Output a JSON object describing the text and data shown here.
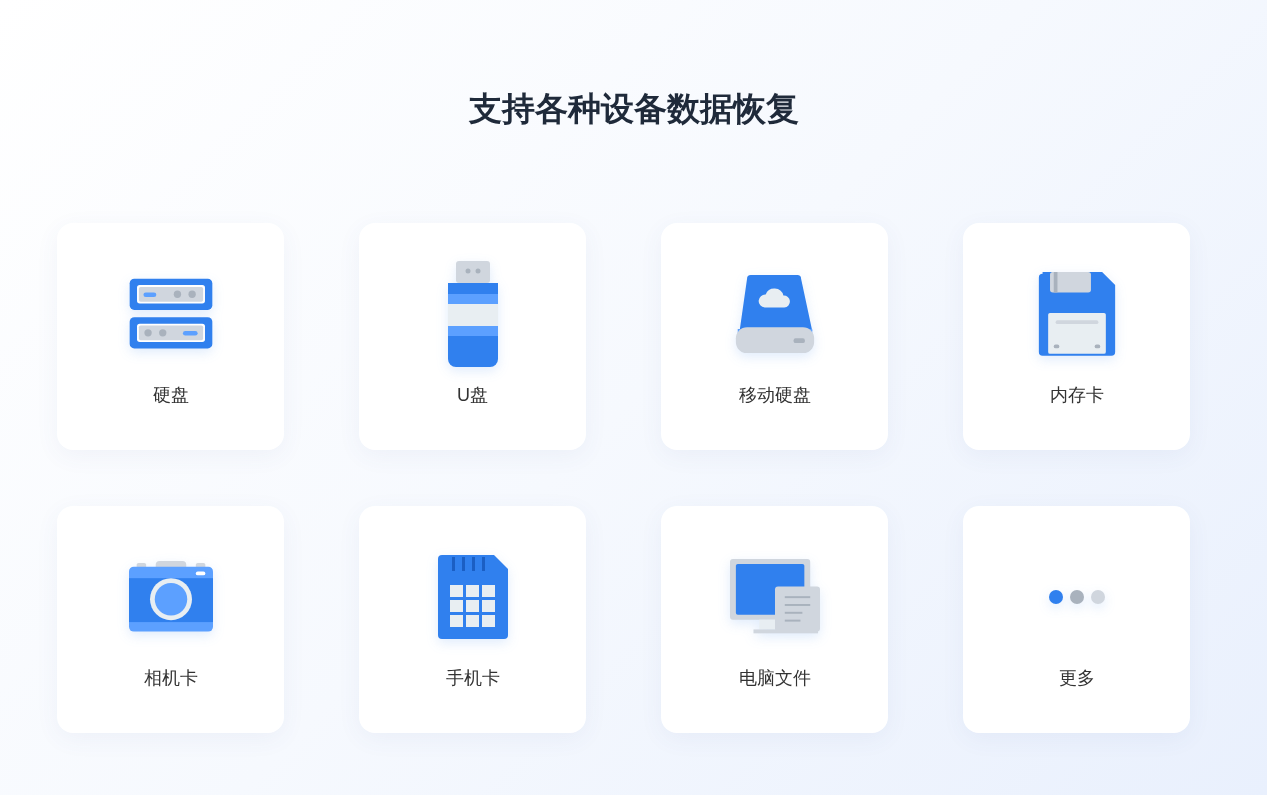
{
  "title": "支持各种设备数据恢复",
  "devices": [
    {
      "kind": "hdd",
      "label": "硬盘"
    },
    {
      "kind": "usb",
      "label": "U盘"
    },
    {
      "kind": "external",
      "label": "移动硬盘"
    },
    {
      "kind": "memory",
      "label": "内存卡"
    },
    {
      "kind": "camera",
      "label": "相机卡"
    },
    {
      "kind": "sim",
      "label": "手机卡"
    },
    {
      "kind": "computer",
      "label": "电脑文件"
    },
    {
      "kind": "more",
      "label": "更多"
    }
  ]
}
